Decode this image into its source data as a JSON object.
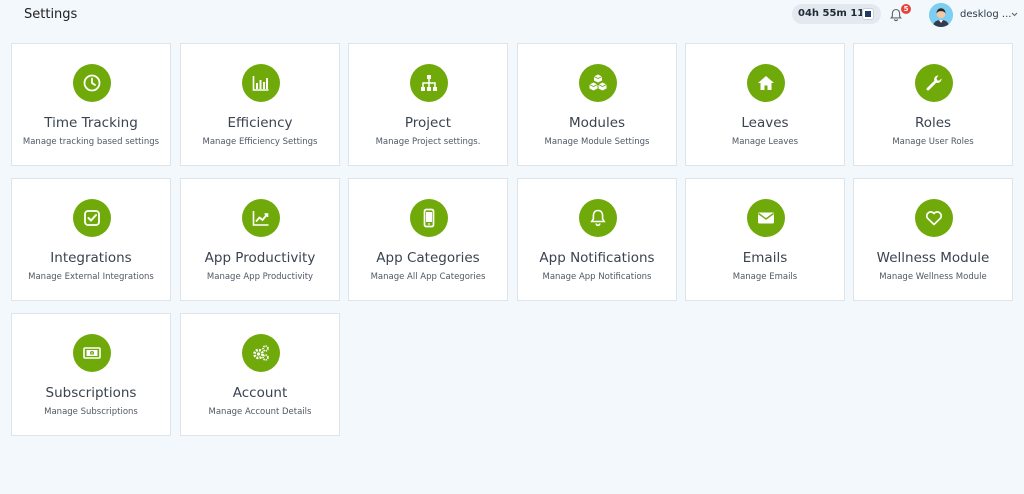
{
  "header": {
    "title": "Settings",
    "timer": "04h 55m 11s",
    "notification_count": "5",
    "username": "desklog ...",
    "icons": [
      "stop-icon",
      "bell-icon",
      "avatar",
      "chevron-down-icon"
    ]
  },
  "colors": {
    "accent": "#6faa0a",
    "background": "#f2f8fc",
    "badge": "#e5453b"
  },
  "cards": [
    {
      "title": "Time Tracking",
      "desc": "Manage tracking based settings",
      "icon": "clock-icon"
    },
    {
      "title": "Efficiency",
      "desc": "Manage Efficiency Settings",
      "icon": "bar-chart-icon"
    },
    {
      "title": "Project",
      "desc": "Manage Project settings.",
      "icon": "sitemap-icon"
    },
    {
      "title": "Modules",
      "desc": "Manage Module Settings",
      "icon": "cubes-icon"
    },
    {
      "title": "Leaves",
      "desc": "Manage Leaves",
      "icon": "home-icon"
    },
    {
      "title": "Roles",
      "desc": "Manage User Roles",
      "icon": "wrench-icon"
    },
    {
      "title": "Integrations",
      "desc": "Manage External Integrations",
      "icon": "check-square-icon"
    },
    {
      "title": "App Productivity",
      "desc": "Manage App Productivity",
      "icon": "line-chart-icon"
    },
    {
      "title": "App Categories",
      "desc": "Manage All App Categories",
      "icon": "mobile-icon"
    },
    {
      "title": "App Notifications",
      "desc": "Manage App Notifications",
      "icon": "bell-icon"
    },
    {
      "title": "Emails",
      "desc": "Manage Emails",
      "icon": "envelope-icon"
    },
    {
      "title": "Wellness Module",
      "desc": "Manage Wellness Module",
      "icon": "heart-icon"
    },
    {
      "title": "Subscriptions",
      "desc": "Manage Subscriptions",
      "icon": "money-icon"
    },
    {
      "title": "Account",
      "desc": "Manage Account Details",
      "icon": "cogs-icon"
    }
  ]
}
